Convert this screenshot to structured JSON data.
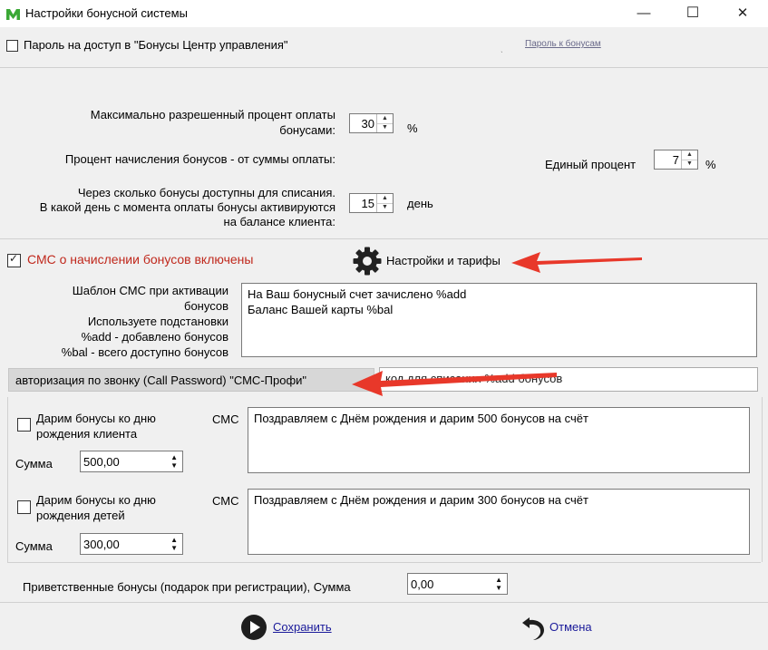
{
  "window": {
    "title": "Настройки бонусной системы",
    "controls": {
      "minimize": "—",
      "maximize": "☐",
      "close": "✕"
    }
  },
  "password": {
    "label": "Пароль на доступ в \"Бонусы Центр управления\"",
    "checked": false,
    "link": "Пароль к бонусам"
  },
  "payment": {
    "max_percent_label": "Максимально разрешенный процент оплаты бонусами:",
    "max_percent_value": "30",
    "percent_unit": "%",
    "accrual_label": "Процент начисления бонусов - от суммы оплаты:",
    "single_percent_label": "Единый процент",
    "single_percent_value": "7",
    "single_percent_unit": "%",
    "delay_label": "Через сколько бонусы доступны для списания.\nВ какой день с момента оплаты бонусы активируются\nна балансе клиента:",
    "delay_value": "15",
    "delay_unit": "день"
  },
  "sms": {
    "enabled_label": "СМС о начислении бонусов включены",
    "enabled": true,
    "settings_label": "Настройки и тарифы",
    "template_help": "Шаблон СМС при активации\nбонусов\nИспользуете подстановки\n%add - добавлено бонусов\n%bal - всего доступно бонусов",
    "template_text": "На Ваш бонусный счет зачислено %add\nБаланс Вашей карты %bal",
    "auth_label": "авторизация по звонку (Call Password) \"СМС-Профи\"",
    "auth_field_value": "код для списания %add бонусов"
  },
  "birthday": {
    "client_label": "Дарим бонусы ко дню\nрождения клиента",
    "client_checked": false,
    "client_sms_label": "СМС",
    "client_sum_label": "Сумма",
    "client_sum_value": "500,00",
    "client_sms_text": "Поздравляем с Днём рождения и дарим 500 бонусов на счёт",
    "kids_label": "Дарим бонусы ко дню\nрождения детей",
    "kids_checked": false,
    "kids_sms_label": "СМС",
    "kids_sum_label": "Сумма",
    "kids_sum_value": "300,00",
    "kids_sms_text": "Поздравляем с Днём рождения и дарим 300 бонусов на счёт"
  },
  "welcome": {
    "label": "Приветственные бонусы (подарок при регистрации), Сумма",
    "value": "0,00"
  },
  "footer": {
    "save_label": "Сохранить",
    "cancel_label": "Отмена"
  },
  "colors": {
    "sms_title": "#c0281c",
    "arrow": "#e8382a",
    "link": "#1a1a9a",
    "logo": "#3aa835"
  }
}
